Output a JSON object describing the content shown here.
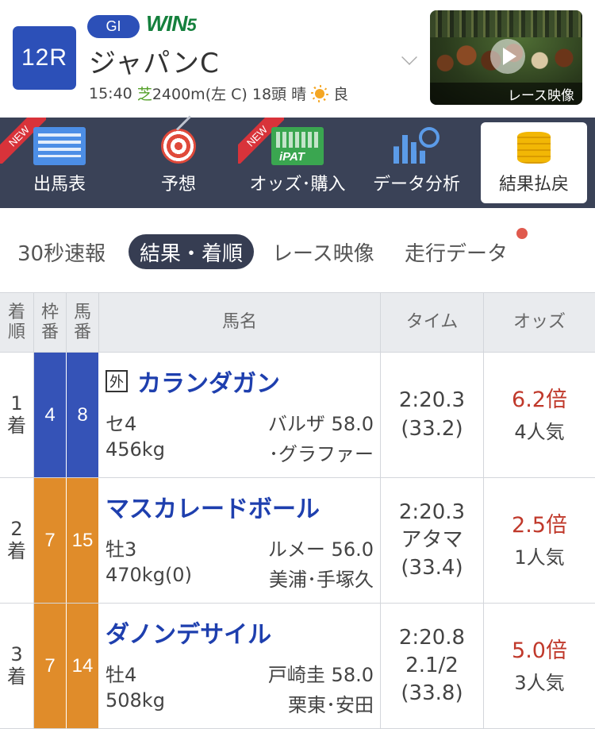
{
  "header": {
    "race_number": "12R",
    "grade": "GI",
    "win5_a": "WIN",
    "win5_b": "5",
    "race_name": "ジャパンC",
    "start_time": "15:40",
    "surface": "芝",
    "distance_course": "2400m(左 C)",
    "runners": "18頭",
    "weather": "晴",
    "track_condition": "良",
    "video_label": "レース映像"
  },
  "nav": {
    "new_badge": "NEW",
    "items": [
      {
        "label": "出馬表",
        "icon": "table-icon",
        "badge": true
      },
      {
        "label": "予想",
        "icon": "target-icon",
        "badge": false
      },
      {
        "label": "オッズ･購入",
        "icon": "ipat-icon",
        "badge": true
      },
      {
        "label": "データ分析",
        "icon": "chart-search-icon",
        "badge": false
      },
      {
        "label": "結果払戻",
        "icon": "coins-icon",
        "badge": false,
        "active": true
      }
    ]
  },
  "tabs": [
    "30秒速報",
    "結果・着順",
    "レース映像",
    "走行データ"
  ],
  "table": {
    "headers": {
      "rank_a": "着",
      "rank_b": "順",
      "waku_a": "枠",
      "waku_b": "番",
      "uma_a": "馬",
      "uma_b": "番",
      "name": "馬名",
      "time": "タイム",
      "odds": "オッズ"
    },
    "rows": [
      {
        "rank": "1",
        "rank_suffix": "着",
        "waku": "4",
        "uma": "8",
        "gai": "外",
        "name": "カランダガン",
        "sex_age": "セ4",
        "jockey_weight": "バルザ 58.0",
        "body_weight": "456kg",
        "trainer": "･グラファー",
        "time": "2:20.3",
        "margin": "",
        "last3f": "(33.2)",
        "odds": "6.2倍",
        "popularity": "4人気"
      },
      {
        "rank": "2",
        "rank_suffix": "着",
        "waku": "7",
        "uma": "15",
        "gai": "",
        "name": "マスカレードボール",
        "sex_age": "牡3",
        "jockey_weight": "ルメー 56.0",
        "body_weight": "470kg(0)",
        "trainer": "美浦･手塚久",
        "time": "2:20.3",
        "margin": "アタマ",
        "last3f": "(33.4)",
        "odds": "2.5倍",
        "popularity": "1人気"
      },
      {
        "rank": "3",
        "rank_suffix": "着",
        "waku": "7",
        "uma": "14",
        "gai": "",
        "name": "ダノンデサイル",
        "sex_age": "牡4",
        "jockey_weight": "戸崎圭 58.0",
        "body_weight": "508kg",
        "trainer": "栗東･安田",
        "time": "2:20.8",
        "margin": "2.1/2",
        "last3f": "(33.8)",
        "odds": "5.0倍",
        "popularity": "3人気"
      }
    ]
  }
}
